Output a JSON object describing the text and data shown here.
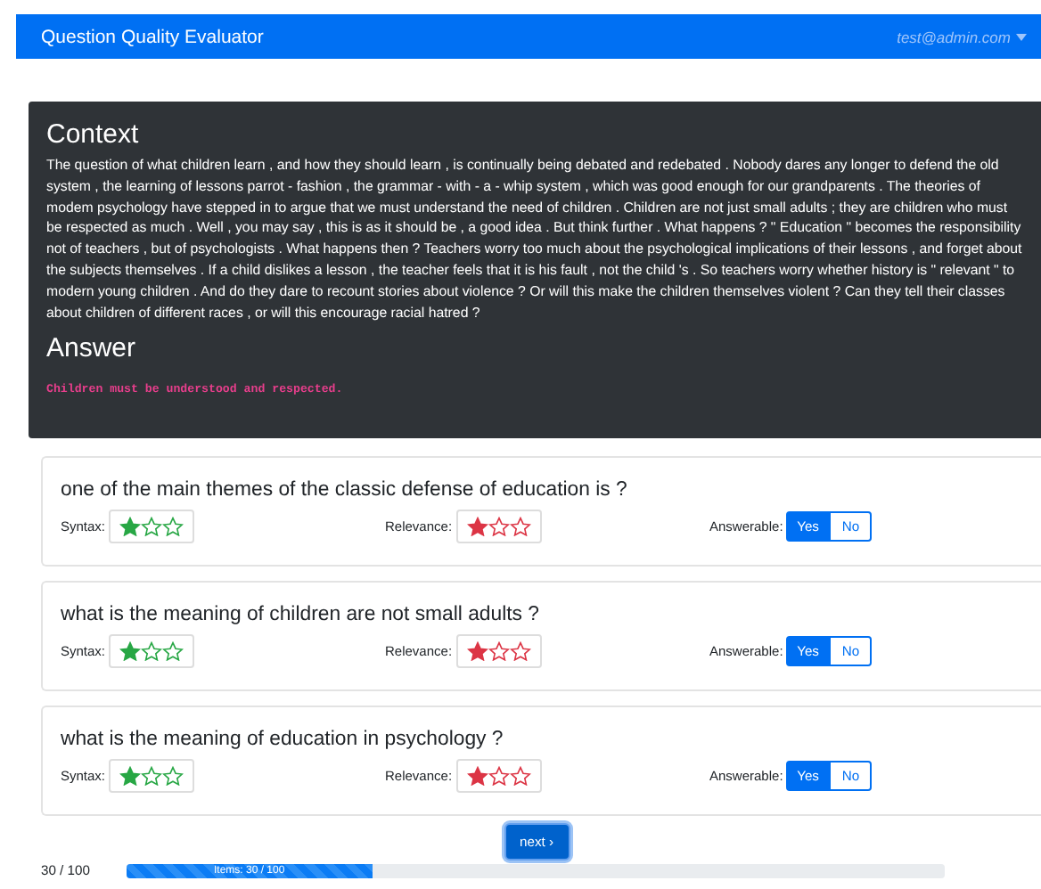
{
  "navbar": {
    "title": "Question Quality Evaluator",
    "user": "test@admin.com"
  },
  "context": {
    "heading": "Context",
    "text": "The question of what children learn , and how they should learn , is continually being debated and redebated . Nobody dares any longer to defend the old system , the learning of lessons parrot - fashion , the grammar - with - a - whip system , which was good enough for our grandparents . The theories of modem psychology have stepped in to argue that we must understand the need of children . Children are not just small adults ; they are children who must be respected as much . Well , you may say , this is as it should be , a good idea . But think further . What happens ? \" Education \" becomes the responsibility not of teachers , but of psychologists . What happens then ? Teachers worry too much about the psychological implications of their lessons , and forget about the subjects themselves . If a child dislikes a lesson , the teacher feels that it is his fault , not the child 's . So teachers worry whether history is \" relevant \" to modern young children . And do they dare to recount stories about violence ? Or will this make the children themselves violent ? Can they tell their classes about children of different races , or will this encourage racial hatred ?",
    "answer_heading": "Answer",
    "answer": "Children must be understood and respected."
  },
  "questions": [
    {
      "text": "one of the main themes of the classic defense of education is ?",
      "syntax": {
        "label": "Syntax:",
        "stars": 1
      },
      "relevance": {
        "label": "Relevance:",
        "stars": 1
      },
      "answerable": {
        "label": "Answerable:",
        "options": [
          {
            "label": "Yes",
            "selected": true
          },
          {
            "label": "No",
            "selected": false
          }
        ]
      }
    },
    {
      "text": "what is the meaning of children are not small adults ?",
      "syntax": {
        "label": "Syntax:",
        "stars": 1
      },
      "relevance": {
        "label": "Relevance:",
        "stars": 1
      },
      "answerable": {
        "label": "Answerable:",
        "options": [
          {
            "label": "Yes",
            "selected": true
          },
          {
            "label": "No",
            "selected": false
          }
        ]
      }
    },
    {
      "text": "what is the meaning of education in psychology ?",
      "syntax": {
        "label": "Syntax:",
        "stars": 1
      },
      "relevance": {
        "label": "Relevance:",
        "stars": 1
      },
      "answerable": {
        "label": "Answerable:",
        "options": [
          {
            "label": "Yes",
            "selected": true
          },
          {
            "label": "No",
            "selected": false
          }
        ]
      }
    }
  ],
  "next_button": "next ›",
  "progress": {
    "count": "30 / 100",
    "level": 0.3,
    "label": "Items: 30 / 100"
  }
}
